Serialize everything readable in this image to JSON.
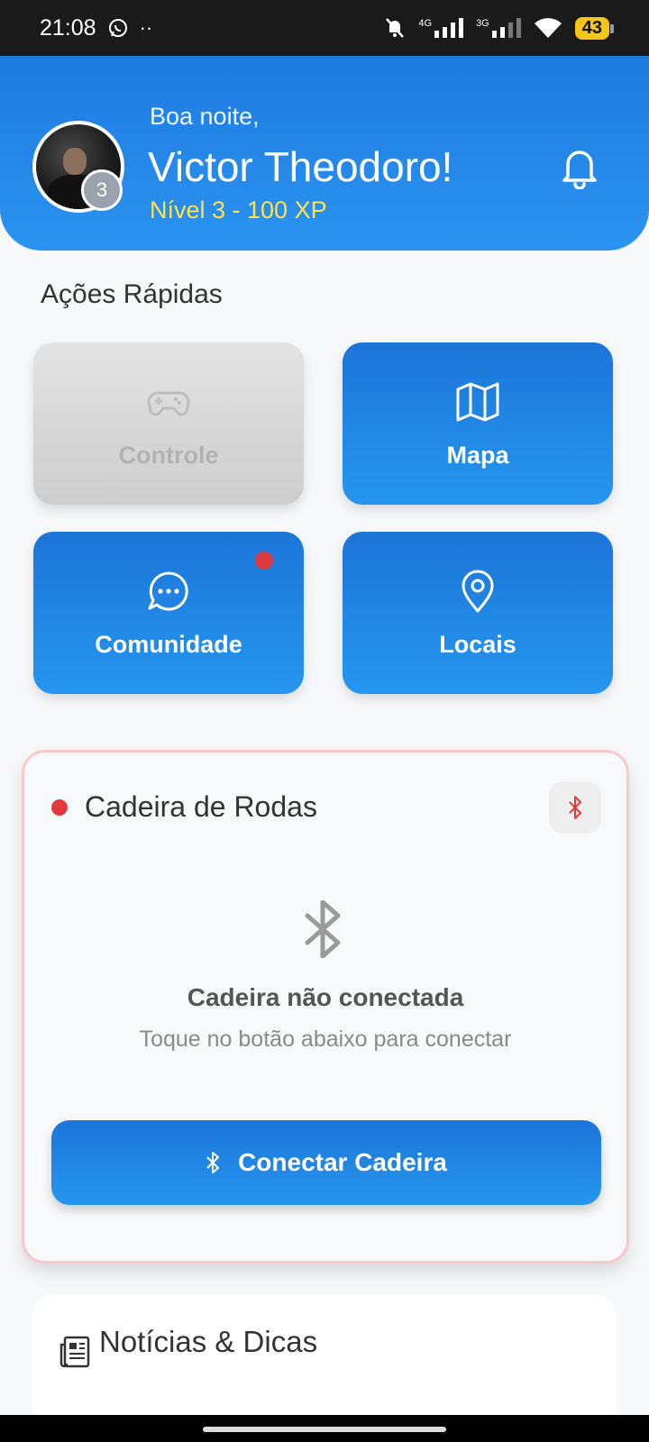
{
  "status_bar": {
    "time": "21:08",
    "battery": "43",
    "network_1": "4G",
    "network_2": "3G"
  },
  "header": {
    "greeting": "Boa noite,",
    "user_name": "Victor Theodoro!",
    "level_text": "Nível 3 - 100 XP",
    "level_badge": "3"
  },
  "quick_actions": {
    "title": "Ações Rápidas",
    "items": [
      {
        "label": "Controle",
        "icon": "gamepad-icon",
        "enabled": false
      },
      {
        "label": "Mapa",
        "icon": "map-icon",
        "enabled": true
      },
      {
        "label": "Comunidade",
        "icon": "chat-icon",
        "enabled": true,
        "has_notification": true
      },
      {
        "label": "Locais",
        "icon": "location-pin-icon",
        "enabled": true
      }
    ]
  },
  "wheelchair": {
    "title": "Cadeira de Rodas",
    "status": "disconnected",
    "status_color": "#e5383e",
    "disconnected_title": "Cadeira não conectada",
    "disconnected_subtitle": "Toque no botão abaixo para conectar",
    "connect_label": "Conectar Cadeira"
  },
  "news": {
    "title": "Notícias & Dicas"
  },
  "colors": {
    "primary": "#1e7be0",
    "level_text": "#ffe14a",
    "alert": "#e0393e"
  }
}
